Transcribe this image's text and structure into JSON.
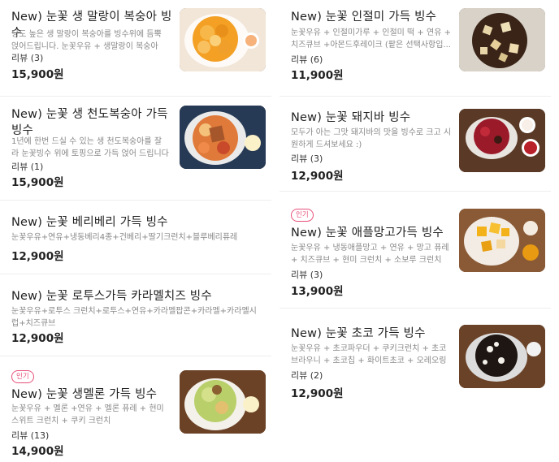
{
  "left": [
    {
      "name": "New) 눈꽃 생 말랑이 복숭아 빙수",
      "desc": "당도 높은 생 말랑이 복숭아를 빙수위에 듬뿍 얹어드립니다. 눈꽃우유 + 생말랑이 복숭아 +소보...",
      "review": "리뷰 (3)",
      "price": "15,900원",
      "image": "peach-bingsu-image"
    },
    {
      "name": "New) 눈꽃 생 천도복숭아 가득 빙수",
      "desc": "1년에 한번 드실 수 있는 생 천도복숭아를 잘라 눈꽃빙수 위에 토핑으로 가득 얹어 드립니다 지금 ...",
      "review": "리뷰 (1)",
      "price": "15,900원",
      "image": "nectarine-bingsu-image"
    },
    {
      "name": "New) 눈꽃 베리베리 가득 빙수",
      "desc": "눈꽃우유+연유+냉동베리4종+건베리+딸기크런치+블루베리퓨레",
      "price": "12,900원"
    },
    {
      "name": "New) 눈꽃 로투스가득 카라멜치즈 빙수",
      "desc": "눈꽃우유+로투스 크런치+로투스+연유+카라멜팝콘+카라멜+카라멜시럽+치즈큐브",
      "price": "12,900원"
    },
    {
      "badge": "인기",
      "name": "New) 눈꽃 생멜론 가득 빙수",
      "desc": "눈꽃우유 + 멜론 +연유 + 멜론 퓨레 + 현미 스위트 크런치 + 쿠키 크런치",
      "review": "리뷰 (13)",
      "price": "14,900원",
      "image": "melon-bingsu-image"
    }
  ],
  "right": [
    {
      "name": "New) 눈꽃 인절미 가득 빙수",
      "desc": "눈꽃우유 + 인절미가루 + 인절미 떡 + 연유 + 치즈큐브 +아몬드후레이크 (팥은 선택사항입...",
      "review": "리뷰 (6)",
      "price": "11,900원",
      "image": "injeolmi-bingsu-image"
    },
    {
      "name": "New) 눈꽃 돼지바 빙수",
      "desc": "모두가 아는 그맛 돼지바의 맛을 빙수로 크고 시원하게 드셔보세요 :)",
      "review": "리뷰 (3)",
      "price": "12,900원",
      "image": "dwaejiba-bingsu-image"
    },
    {
      "badge": "인기",
      "name": "New) 눈꽃 애플망고가득 빙수",
      "desc": "눈꽃우유 + 냉동애플망고 + 연유 + 망고 퓨레 + 치즈큐브 + 현미 크런치 + 소보루 크런치 구...",
      "review": "리뷰 (3)",
      "price": "13,900원",
      "image": "mango-bingsu-image"
    },
    {
      "name": "New) 눈꽃 초코 가득 빙수",
      "desc": "눈꽃우유 + 초코파우더 + 쿠키크런치 + 초코브라우니 + 초코칩 + 화이트초코 + 오레오링 + ...",
      "review": "리뷰 (2)",
      "price": "12,900원",
      "image": "choco-bingsu-image"
    }
  ]
}
